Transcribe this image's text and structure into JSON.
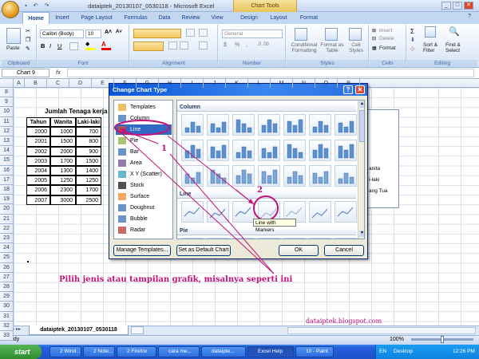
{
  "window": {
    "title": "dataiptek_20130107_0530118 - Microsoft Excel",
    "contextual_tab": "Chart Tools",
    "buttons": [
      "_",
      "□",
      "✕"
    ]
  },
  "ribbon": {
    "tabs": [
      "Home",
      "Insert",
      "Page Layout",
      "Formulas",
      "Data",
      "Review",
      "View",
      "Design",
      "Layout",
      "Format"
    ],
    "active_tab": "Home",
    "clipboard": {
      "label": "Clipboard",
      "paste": "Paste"
    },
    "font": {
      "label": "Font",
      "name": "Calibri (Body)",
      "size": "10"
    },
    "alignment": {
      "label": "Alignment"
    },
    "number": {
      "label": "Number",
      "format": "General"
    },
    "styles": {
      "label": "Styles",
      "conditional": "Conditional Formatting",
      "table": "Format as Table",
      "cell": "Cell Styles"
    },
    "cells": {
      "label": "Cells",
      "insert": "Insert",
      "delete": "Delete",
      "format": "Format"
    },
    "editing": {
      "label": "Editing",
      "sort": "Sort & Filter",
      "find": "Find & Select"
    }
  },
  "formula_bar": {
    "name_box": "Chart 9",
    "fx": "fx"
  },
  "columns": [
    "A",
    "B",
    "C",
    "D",
    "E",
    "F",
    "G",
    "H",
    "I",
    "J",
    "K",
    "L",
    "M",
    "N",
    "O",
    "P"
  ],
  "rows": [
    "8",
    "9",
    "10",
    "11",
    "12",
    "13",
    "14",
    "15",
    "16",
    "17",
    "18",
    "19",
    "20",
    "21",
    "22",
    "23",
    "24",
    "25",
    "26",
    "27",
    "28",
    "29",
    "30",
    "31",
    "32",
    "33"
  ],
  "sheet_table": {
    "title": "Jumlah Tenaga kerja d",
    "headers": [
      "Tahun",
      "Wanita",
      "Laki-laki"
    ],
    "rows": [
      [
        "2000",
        "1000",
        "700"
      ],
      [
        "2001",
        "1500",
        "800"
      ],
      [
        "2002",
        "2000",
        "900"
      ],
      [
        "2003",
        "1700",
        "1500"
      ],
      [
        "2004",
        "1300",
        "1400"
      ],
      [
        "2005",
        "1250",
        "1250"
      ],
      [
        "2006",
        "2300",
        "1700"
      ],
      [
        "2007",
        "3000",
        "2500"
      ]
    ]
  },
  "chart_legend_partial": [
    "anita",
    "i-laki",
    "ang Tua"
  ],
  "dialog": {
    "title": "Change Chart Type",
    "categories": [
      "Templates",
      "Column",
      "Line",
      "Pie",
      "Bar",
      "Area",
      "X Y (Scatter)",
      "Stock",
      "Surface",
      "Doughnut",
      "Bubble",
      "Radar"
    ],
    "selected_category": "Line",
    "sections": [
      "Column",
      "Line",
      "Pie"
    ],
    "tooltip": "Line with Markers",
    "manage_button": "Manage Templates...",
    "default_button": "Set as Default Chart",
    "ok": "OK",
    "cancel": "Cancel",
    "help": "?",
    "close": "✕"
  },
  "annotations": {
    "step1": "1",
    "step2": "2",
    "caption": "Pilih jenis atau tampilan grafik, misalnya seperti ini",
    "blog": "dataiptek.blogspot.com",
    "color": "#c2127a"
  },
  "sheet_tabs": {
    "active": "dataiptek_20130107_0530118"
  },
  "status_bar": {
    "left": "Ready",
    "zoom": "100%"
  },
  "taskbar": {
    "start": "start",
    "tasks": [
      "2 Wind...",
      "2 Note...",
      "2 Firefox",
      "cara me...",
      "dataipte...",
      "Excel Help",
      "10 - Paint"
    ],
    "tray_lang": "EN",
    "tray_label": "Desktop",
    "clock": "12:26 PM"
  }
}
